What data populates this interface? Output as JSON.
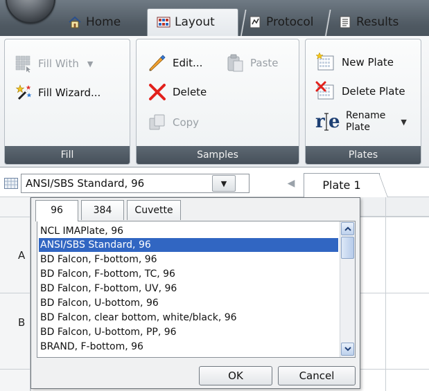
{
  "tabs": [
    {
      "label": "Home",
      "icon": "home-icon"
    },
    {
      "label": "Layout",
      "icon": "layout-icon"
    },
    {
      "label": "Protocol",
      "icon": "protocol-icon"
    },
    {
      "label": "Results",
      "icon": "results-icon"
    }
  ],
  "active_tab": "Layout",
  "ribbon": {
    "fill": {
      "label": "Fill",
      "fill_with": "Fill With",
      "fill_wizard": "Fill Wizard..."
    },
    "samples": {
      "label": "Samples",
      "edit": "Edit...",
      "paste": "Paste",
      "delete": "Delete",
      "copy": "Copy"
    },
    "plates": {
      "label": "Plates",
      "new_plate": "New Plate",
      "delete_plate": "Delete Plate",
      "rename_plate_line1": "Rename",
      "rename_plate_line2": "Plate"
    }
  },
  "plate_bar": {
    "selected_plate_type": "ANSI/SBS Standard, 96",
    "plate_tab": "Plate 1"
  },
  "grid": {
    "rows": [
      "A",
      "B"
    ]
  },
  "popup": {
    "tabs": [
      "96",
      "384",
      "Cuvette"
    ],
    "active_tab": "96",
    "items": [
      "NCL IMAPlate, 96",
      "ANSI/SBS Standard, 96",
      "BD Falcon, F-bottom, 96",
      "BD Falcon, F-bottom, TC, 96",
      "BD Falcon, F-bottom, UV, 96",
      "BD Falcon, U-bottom, 96",
      "BD Falcon, clear bottom, white/black, 96",
      "BD Falcon, U-bottom, PP, 96",
      "BRAND, F-bottom, 96"
    ],
    "selected_item": "ANSI/SBS Standard, 96",
    "ok": "OK",
    "cancel": "Cancel"
  },
  "colors": {
    "selection": "#3166c2",
    "group_label_bg": "#4f5962",
    "tabstrip_bg": "#5a646d"
  }
}
